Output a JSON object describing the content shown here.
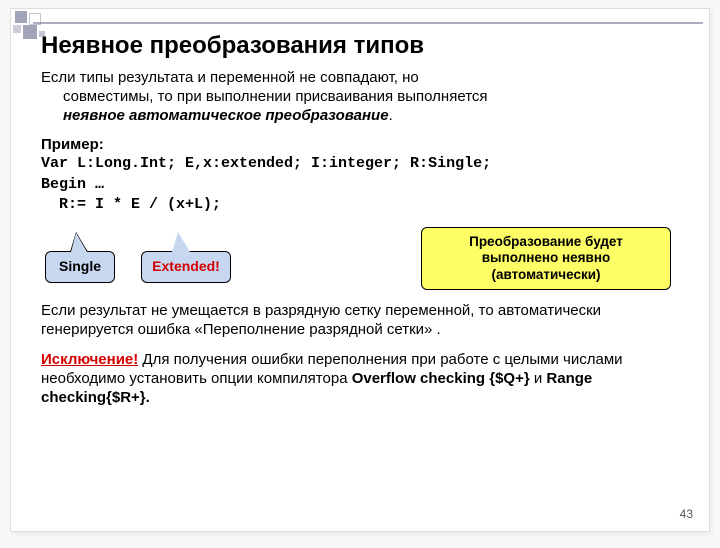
{
  "title": "Неявное преобразования типов",
  "intro": {
    "line1": "Если типы результата и переменной не совпадают, но",
    "line2": "совместимы, то при выполнении присваивания выполняется",
    "line3_em": "неявное автоматическое преобразование",
    "line3_tail": "."
  },
  "example": {
    "label": "Пример:",
    "code1": "Var L:Long.Int; E,x:extended; I:integer; R:Single;",
    "code2": "Begin …",
    "code3": "  R:= I * E / (x+L);"
  },
  "callouts": {
    "single": "Single",
    "extended": "Extended!",
    "note": "Преобразование будет выполнено неявно (автоматически)"
  },
  "para2": "Если результат не умещается в разрядную сетку переменной, то автоматически генерируется ошибка «Переполнение разрядной сетки» .",
  "para3": {
    "exc": "Исключение!",
    "text1": " Для получения ошибки переполнения при работе с целыми числами необходимо установить опции компилятора ",
    "opt1": "Overflow checking {$Q+}",
    "and": " и ",
    "opt2": "Range checking{$R+}.",
    "tail": ""
  },
  "page": "43"
}
